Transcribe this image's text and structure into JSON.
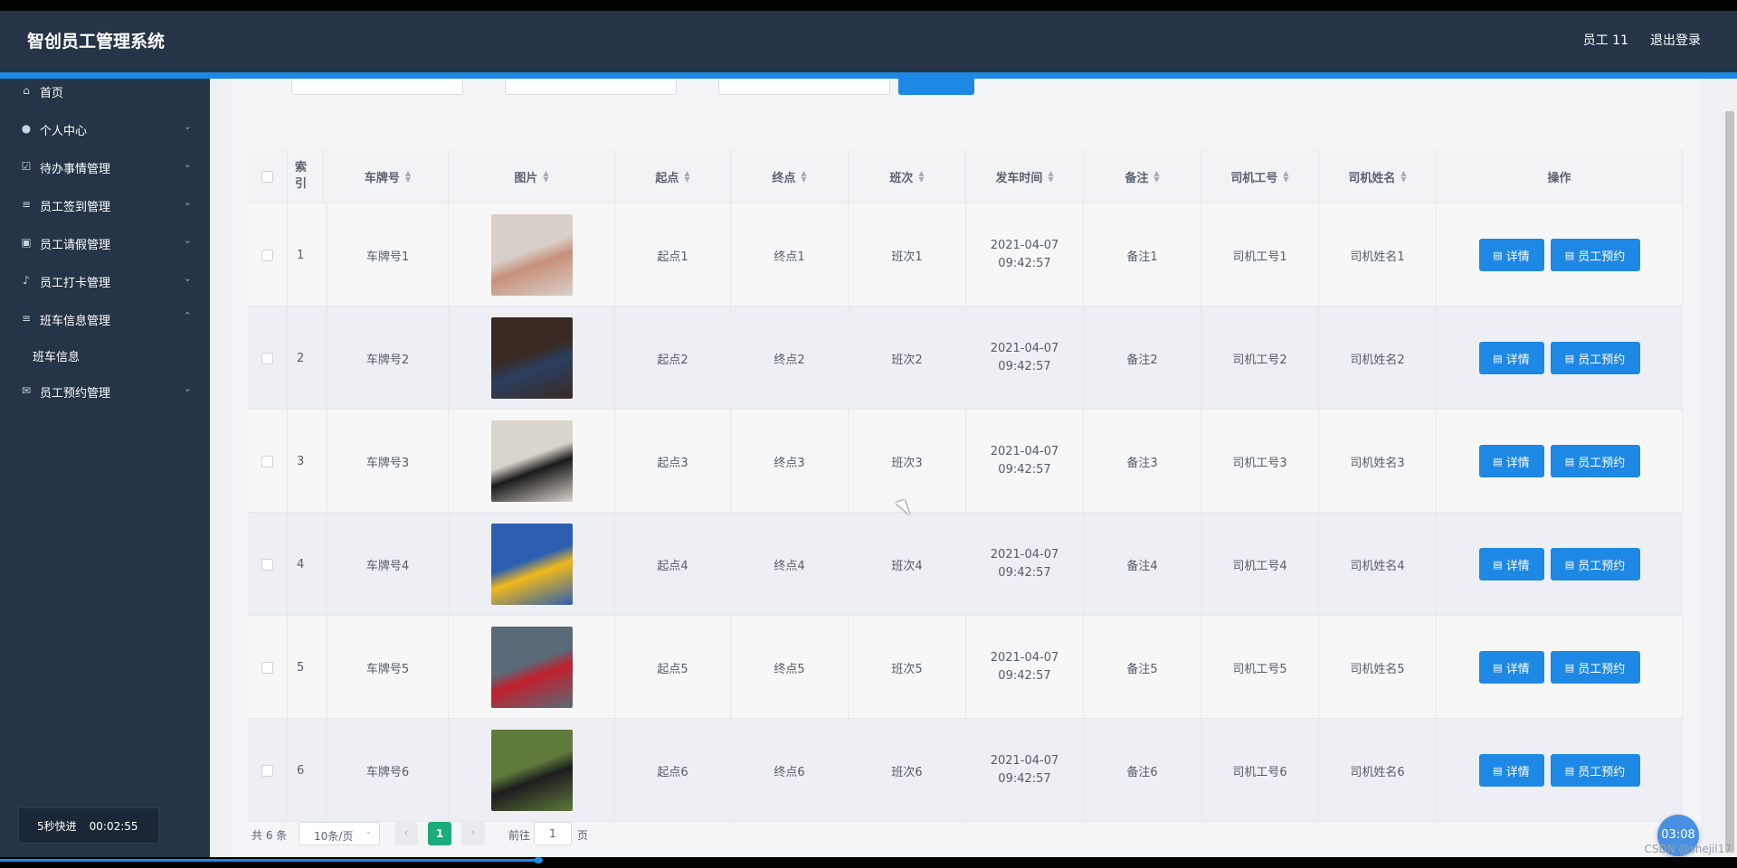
{
  "header": {
    "title": "智创员工管理系统",
    "user": "员工 11",
    "logout": "退出登录"
  },
  "sidebar": {
    "items": [
      {
        "label": "首页",
        "icon": "home-icon",
        "glyph": "⌂"
      },
      {
        "label": "个人中心",
        "icon": "user-icon",
        "glyph": "●"
      },
      {
        "label": "待办事情管理",
        "icon": "checkbox-icon",
        "glyph": "☑"
      },
      {
        "label": "员工签到管理",
        "icon": "list-icon",
        "glyph": "≡"
      },
      {
        "label": "员工请假管理",
        "icon": "clipboard-icon",
        "glyph": "▣"
      },
      {
        "label": "员工打卡管理",
        "icon": "microphone-icon",
        "glyph": "♪"
      },
      {
        "label": "班车信息管理",
        "icon": "list-icon",
        "glyph": "≡"
      },
      {
        "label": "员工预约管理",
        "icon": "mail-icon",
        "glyph": "✉"
      }
    ],
    "sub_item": "班车信息"
  },
  "timer": {
    "label": "5秒快进",
    "time": "00:02:55"
  },
  "table": {
    "headers": [
      "索引",
      "车牌号",
      "图片",
      "起点",
      "终点",
      "班次",
      "发车时间",
      "备注",
      "司机工号",
      "司机姓名",
      "操作"
    ],
    "rows": [
      {
        "index": "1",
        "plate": "车牌号1",
        "start": "起点1",
        "end": "终点1",
        "shift": "班次1",
        "time": "2021-04-07 09:42:57",
        "note": "备注1",
        "driver_id": "司机工号1",
        "driver_name": "司机姓名1",
        "thumb_colors": [
          "#d8d0c8",
          "#c8907a"
        ]
      },
      {
        "index": "2",
        "plate": "车牌号2",
        "start": "起点2",
        "end": "终点2",
        "shift": "班次2",
        "time": "2021-04-07 09:42:57",
        "note": "备注2",
        "driver_id": "司机工号2",
        "driver_name": "司机姓名2",
        "thumb_colors": [
          "#3a2a24",
          "#2a3f60"
        ]
      },
      {
        "index": "3",
        "plate": "车牌号3",
        "start": "起点3",
        "end": "终点3",
        "shift": "班次3",
        "time": "2021-04-07 09:42:57",
        "note": "备注3",
        "driver_id": "司机工号3",
        "driver_name": "司机姓名3",
        "thumb_colors": [
          "#d9d4cc",
          "#1a1a1a"
        ]
      },
      {
        "index": "4",
        "plate": "车牌号4",
        "start": "起点4",
        "end": "终点4",
        "shift": "班次4",
        "time": "2021-04-07 09:42:57",
        "note": "备注4",
        "driver_id": "司机工号4",
        "driver_name": "司机姓名4",
        "thumb_colors": [
          "#2c5fb0",
          "#f0b81c"
        ]
      },
      {
        "index": "5",
        "plate": "车牌号5",
        "start": "起点5",
        "end": "终点5",
        "shift": "班次5",
        "time": "2021-04-07 09:42:57",
        "note": "备注5",
        "driver_id": "司机工号5",
        "driver_name": "司机姓名5",
        "thumb_colors": [
          "#5a6a78",
          "#c0202c"
        ]
      },
      {
        "index": "6",
        "plate": "车牌号6",
        "start": "起点6",
        "end": "终点6",
        "shift": "班次6",
        "time": "2021-04-07 09:42:57",
        "note": "备注6",
        "driver_id": "司机工号6",
        "driver_name": "司机姓名6",
        "thumb_colors": [
          "#5f7a3a",
          "#1c1c1e"
        ]
      }
    ],
    "detail_label": "详情",
    "book_label": "员工预约"
  },
  "pager": {
    "total": "共 6 条",
    "page_size": "10条/页",
    "current_page": "1",
    "goto_prefix": "前往",
    "goto_value": "1",
    "goto_suffix": "页"
  },
  "fab_time": "03:08",
  "watermark": "CSDN @shejil17",
  "colors": {
    "accent": "#1e88e5",
    "sidebar": "#253446",
    "page_active": "#1aac7a"
  }
}
